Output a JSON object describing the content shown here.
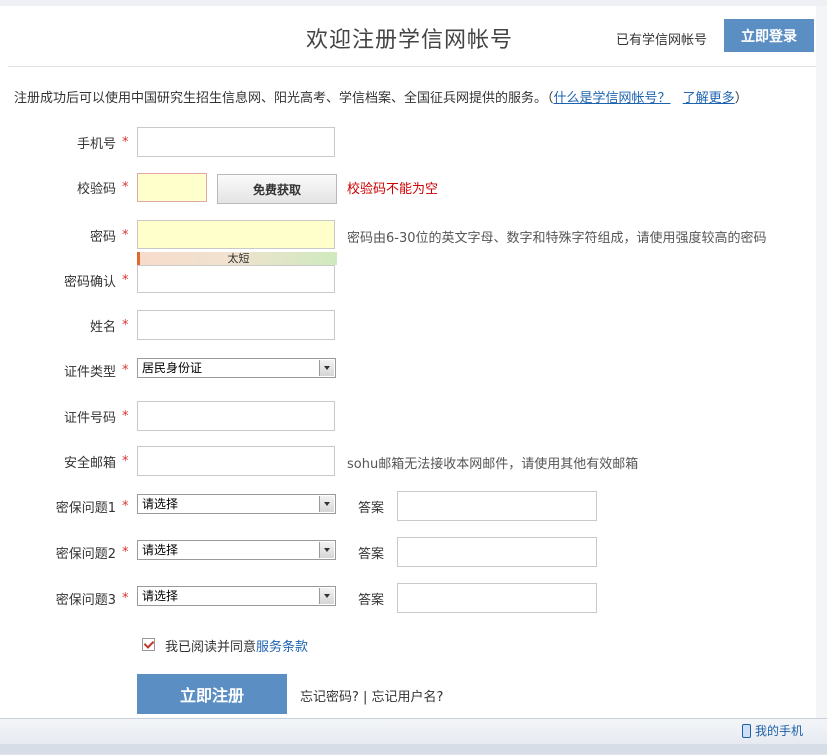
{
  "header": {
    "title": "欢迎注册学信网帐号",
    "has_account": "已有学信网帐号",
    "login_button": "立即登录"
  },
  "intro": {
    "text": "注册成功后可以使用中国研究生招生信息网、阳光高考、学信档案、全国征兵网提供的服务。（",
    "link_what": "什么是学信网帐号？",
    "link_more": "了解更多",
    "close_paren": "）"
  },
  "form": {
    "star": "*",
    "phone_label": "手机号",
    "code_label": "校验码",
    "get_code_button": "免费获取",
    "code_error": "校验码不能为空",
    "password_label": "密码",
    "password_hint": "密码由6-30位的英文字母、数字和特殊字符组成，请使用强度较高的密码",
    "strength_text": "太短",
    "confirm_label": "密码确认",
    "name_label": "姓名",
    "id_type_label": "证件类型",
    "id_type_value": "居民身份证",
    "id_number_label": "证件号码",
    "email_label": "安全邮箱",
    "email_hint": "sohu邮箱无法接收本网邮件，请使用其他有效邮箱",
    "q1_label": "密保问题1",
    "q2_label": "密保问题2",
    "q3_label": "密保问题3",
    "question_placeholder": "请选择",
    "answer_label": "答案",
    "agree_text": "我已阅读并同意",
    "agree_link": "服务条款",
    "register_button": "立即注册",
    "forgot_text": "忘记密码? | 忘记用户名?"
  },
  "statusbar": {
    "my_phone": "我的手机"
  }
}
